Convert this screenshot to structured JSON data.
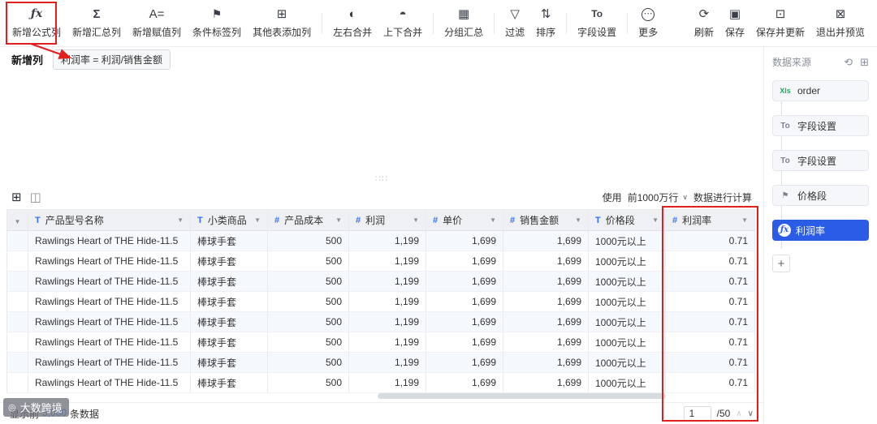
{
  "toolbar": {
    "left_items": [
      {
        "name": "add-formula-column",
        "icon": "fx-icon",
        "label": "新增公式列"
      },
      {
        "name": "add-summary-column",
        "icon": "sigma-icon",
        "label": "新增汇总列"
      },
      {
        "name": "add-assignment-column",
        "icon": "assign-icon",
        "label": "新增赋值列"
      },
      {
        "name": "conditional-tag-column",
        "icon": "flag-icon",
        "label": "条件标签列"
      },
      {
        "name": "add-column-from-other-table",
        "icon": "table-add-icon",
        "label": "其他表添加列"
      },
      {
        "name": "merge-left-right",
        "icon": "merge-lr-icon",
        "label": "左右合并"
      },
      {
        "name": "merge-top-bottom",
        "icon": "merge-tb-icon",
        "label": "上下合并"
      },
      {
        "name": "group-summary",
        "icon": "group-sum-icon",
        "label": "分组汇总"
      },
      {
        "name": "filter",
        "icon": "filter-icon",
        "label": "过滤"
      },
      {
        "name": "sort",
        "icon": "sort-icon",
        "label": "排序"
      },
      {
        "name": "field-settings",
        "icon": "field-icon",
        "label": "字段设置"
      },
      {
        "name": "more",
        "icon": "more-icon",
        "label": "更多"
      }
    ],
    "right_items": [
      {
        "name": "refresh",
        "icon": "refresh-icon",
        "label": "刷新"
      },
      {
        "name": "save",
        "icon": "save-icon",
        "label": "保存"
      },
      {
        "name": "save-and-update",
        "icon": "save-update-icon",
        "label": "保存并更新"
      },
      {
        "name": "exit-and-preview",
        "icon": "exit-preview-icon",
        "label": "退出并预览"
      }
    ]
  },
  "subheader": {
    "label": "新增列",
    "formula": "利润率 = 利润/销售金额"
  },
  "table_toolbar": {
    "usage_prefix": "使用",
    "row_limit": "前1000万行",
    "usage_suffix": "数据进行计算"
  },
  "table": {
    "columns": [
      {
        "name": "product-model-name",
        "type": "T",
        "label": "产品型号名称"
      },
      {
        "name": "subcategory",
        "type": "T",
        "label": "小类商品"
      },
      {
        "name": "product-cost",
        "type": "#",
        "label": "产品成本"
      },
      {
        "name": "profit",
        "type": "#",
        "label": "利润"
      },
      {
        "name": "unit-price",
        "type": "#",
        "label": "单价"
      },
      {
        "name": "sales-amount",
        "type": "#",
        "label": "销售金额"
      },
      {
        "name": "price-band",
        "type": "T",
        "label": "价格段"
      },
      {
        "name": "profit-rate",
        "type": "#",
        "label": "利润率"
      }
    ],
    "rows": [
      [
        "Rawlings Heart of THE Hide-11.5",
        "棒球手套",
        "500",
        "1,199",
        "1,699",
        "1,699",
        "1000元以上",
        "0.71"
      ],
      [
        "Rawlings Heart of THE Hide-11.5",
        "棒球手套",
        "500",
        "1,199",
        "1,699",
        "1,699",
        "1000元以上",
        "0.71"
      ],
      [
        "Rawlings Heart of THE Hide-11.5",
        "棒球手套",
        "500",
        "1,199",
        "1,699",
        "1,699",
        "1000元以上",
        "0.71"
      ],
      [
        "Rawlings Heart of THE Hide-11.5",
        "棒球手套",
        "500",
        "1,199",
        "1,699",
        "1,699",
        "1000元以上",
        "0.71"
      ],
      [
        "Rawlings Heart of THE Hide-11.5",
        "棒球手套",
        "500",
        "1,199",
        "1,699",
        "1,699",
        "1000元以上",
        "0.71"
      ],
      [
        "Rawlings Heart of THE Hide-11.5",
        "棒球手套",
        "500",
        "1,199",
        "1,699",
        "1,699",
        "1000元以上",
        "0.71"
      ],
      [
        "Rawlings Heart of THE Hide-11.5",
        "棒球手套",
        "500",
        "1,199",
        "1,699",
        "1,699",
        "1000元以上",
        "0.71"
      ],
      [
        "Rawlings Heart of THE Hide-11.5",
        "棒球手套",
        "500",
        "1,199",
        "1,699",
        "1,699",
        "1000元以上",
        "0.71"
      ]
    ]
  },
  "footer": {
    "summary_prefix": "显示前",
    "summary_count": "5,000",
    "summary_suffix": "条数据",
    "page_current": "1",
    "page_total": "/50"
  },
  "sidebar": {
    "title": "数据来源",
    "nodes": [
      {
        "name": "node-order",
        "icon": "xls-icon",
        "label": "order",
        "active": false
      },
      {
        "name": "node-field-settings-1",
        "icon": "field-icon",
        "label": "字段设置",
        "active": false
      },
      {
        "name": "node-field-settings-2",
        "icon": "field-icon",
        "label": "字段设置",
        "active": false
      },
      {
        "name": "node-price-band",
        "icon": "tag-icon",
        "label": "价格段",
        "active": false
      },
      {
        "name": "node-profit-rate",
        "icon": "fx-circle-icon",
        "label": "利润率",
        "active": true
      }
    ]
  },
  "watermark": {
    "text": "大数跨境"
  }
}
